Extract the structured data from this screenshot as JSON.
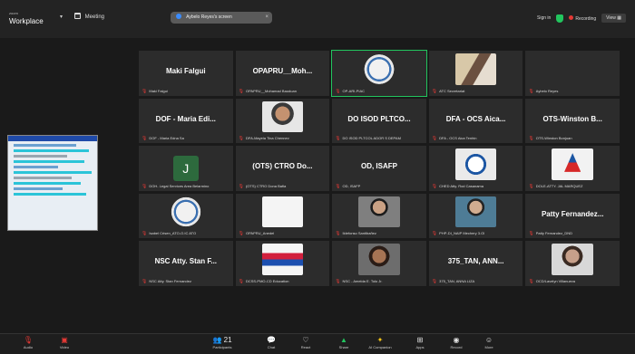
{
  "app": {
    "brand_small": "zoom",
    "brand": "Workplace",
    "meeting_label": "Meeting",
    "share_text": "Aybelo Reyes's screen",
    "signin": "Sign in",
    "recording": "Recording",
    "view": "View"
  },
  "tiles": [
    {
      "name": "Maki Falgui",
      "label": "Maki Falgui",
      "video": ""
    },
    {
      "name": "OPAPRU__Moh...",
      "label": "OPAPRU__Mohamad Bauduan",
      "video": ""
    },
    {
      "name": "",
      "label": "OP-ARI-PIAC",
      "video": "seal",
      "active": true
    },
    {
      "name": "",
      "label": "ATC Secretariat",
      "video": "room"
    },
    {
      "name": "",
      "label": "Aybelo Reyes",
      "video": ""
    },
    {
      "name": "DOF - Maria Edi...",
      "label": "DOF - Maria Edna Sa",
      "video": ""
    },
    {
      "name": "",
      "label": "DFA-Mayela Tina Chennev",
      "video": "face"
    },
    {
      "name": "DO ISOD PLTCO...",
      "label": "DO ISOD PLTCOL ADOR S DEPAM",
      "video": ""
    },
    {
      "name": "DFA - OCS Aica...",
      "label": "DFA - OCS Aica Tenhin",
      "video": ""
    },
    {
      "name": "OTS-Winston B...",
      "label": "OTS-Winston Bonjuan",
      "video": ""
    },
    {
      "name": "",
      "label": "DOH- Legal Services Area Belarmino",
      "video": "initial",
      "initial": "J"
    },
    {
      "name": "(OTS)  CTRO Do...",
      "label": "(OTS) CTRO Dona Bafia",
      "video": ""
    },
    {
      "name": "OD, ISAFP",
      "label": "OD, ISAFP",
      "video": ""
    },
    {
      "name": "",
      "label": "CHED Atty. Rod Casanama",
      "video": "circle"
    },
    {
      "name": "",
      "label": "DOLE-ATTY. JAL MARQUEZ",
      "video": "dole"
    },
    {
      "name": "",
      "label": "Isabel Crisen_ATO-O.IC ATO",
      "video": "seal"
    },
    {
      "name": "",
      "label": "OPAPRU_Anedel",
      "video": "white"
    },
    {
      "name": "",
      "label": "Ildefonso Santibañez",
      "video": "man"
    },
    {
      "name": "",
      "label": "PHP-DI_NAIP Mechery 3.OI",
      "video": "man2"
    },
    {
      "name": "Patty Fernandez...",
      "label": "Patty Fernandez_DND",
      "video": ""
    },
    {
      "name": "NSC Atty. Stan F...",
      "label": "NSC Atty. Stan Fernandez",
      "video": ""
    },
    {
      "name": "",
      "label": "DCSS-PMO-CD Education",
      "video": "flag"
    },
    {
      "name": "",
      "label": "NSC - Amelda E. Tolo Jr.",
      "video": "woman"
    },
    {
      "name": "375_TAN, ANN...",
      "label": "375_TAN, ANNA LIZA",
      "video": ""
    },
    {
      "name": "",
      "label": "OCD/Lavelyn Villanueva",
      "video": "woman2"
    }
  ],
  "toolbar": {
    "audio": "Audio",
    "video": "Video",
    "participants": "Participants",
    "participant_count": "21",
    "chat": "Chat",
    "react": "React",
    "share": "Share",
    "ai_companion": "AI Companion",
    "apps": "Apps",
    "record": "Record",
    "more": "More"
  }
}
